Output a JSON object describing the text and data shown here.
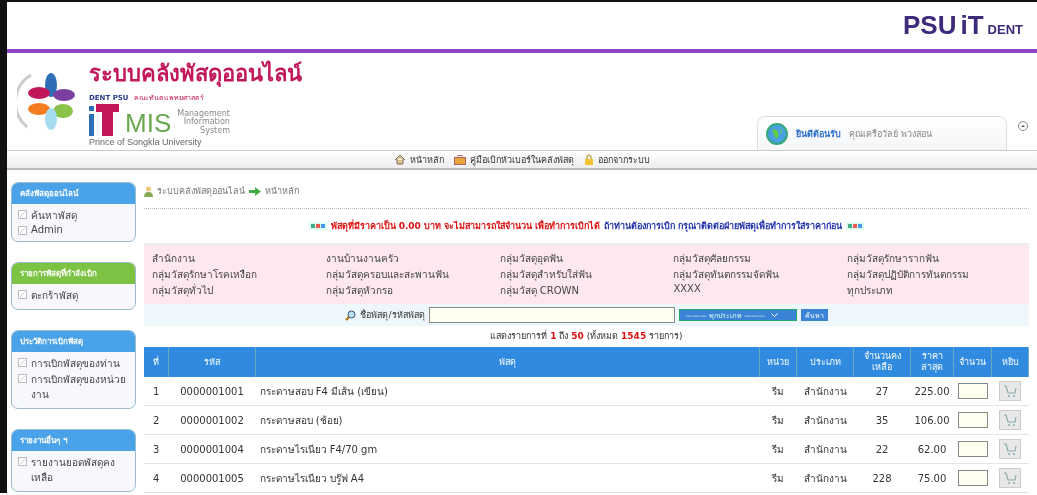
{
  "top_logo": {
    "parts": [
      "PSU",
      "iT",
      "DENT"
    ]
  },
  "header": {
    "title": "ระบบคลังพัสดุออนไลน์",
    "org_short": "DENT PSU",
    "org_name": "คณะทันตแพทยศาสตร์",
    "product": "MIS",
    "product_sub": [
      "Management",
      "Information",
      "System"
    ],
    "university": "Prince of Songkla University"
  },
  "welcome": {
    "greeting": "ยินดีต้อนรับ",
    "user": "คุณเครือวัลย์ พวงสอน"
  },
  "nav": [
    {
      "label": "หน้าหลัก",
      "kind": "home"
    },
    {
      "label": "คู่มือเบิกหัวเบอร์ในคลังพัสดุ",
      "kind": "manual"
    },
    {
      "label": "ออกจากระบบ",
      "kind": "logout"
    }
  ],
  "sidebar": [
    {
      "title": "คลังพัสดุออนไลน์",
      "color": "#4aa3e8",
      "items": [
        "ค้นหาพัสดุ",
        "Admin"
      ]
    },
    {
      "title": "รายการพัสดุที่กำลังเบิก",
      "color": "#7cc243",
      "items": [
        "ตะกร้าพัสดุ"
      ]
    },
    {
      "title": "ประวัติการเบิกพัสดุ",
      "color": "#4aa3e8",
      "items": [
        "การเบิกพัสดุของท่าน",
        "การเบิกพัสดุของหน่วยงาน"
      ]
    },
    {
      "title": "รายงานอื่นๆ ฯ",
      "color": "#4aa3e8",
      "items": [
        "รายงานยอดพัสดุคงเหลือ"
      ]
    }
  ],
  "breadcrumb": [
    "ระบบคลังพัสดุออนไลน์",
    "หน้าหลัก"
  ],
  "notice": {
    "warning": "พัสดุที่มีราคาเป็น 0.00 บาท จะไม่สามารถใส่จำนวน เพื่อทำการเบิกได้",
    "advice": "ถ้าท่านต้องการเบิก กรุณาติดต่อฝ่ายพัสดุเพื่อทำการใส่ราคาก่อน"
  },
  "categories": [
    "สำนักงาน",
    "งานบ้านงานครัว",
    "กลุ่มวัสดุอุดฟัน",
    "กลุ่มวัสดุศัลยกรรม",
    "กลุ่มวัสดุรักษารากฟัน",
    "กลุ่มวัสดุรักษาโรคเหงือก",
    "กลุ่มวัสดุครอบและสะพานฟัน",
    "กลุ่มวัสดุสำหรับใส่ฟัน",
    "กลุ่มวัสดุทันตกรรมจัดฟัน",
    "กลุ่มวัสดุปฏิบัติการทันตกรรม",
    "กลุ่มวัสดุทั่วไป",
    "กลุ่มวัสดุหัวกรอ",
    "กลุ่มวัสดุ CROWN",
    "XXXX",
    "ทุกประเภท"
  ],
  "search": {
    "label": "ชื่อพัสดุ/รหัสพัสดุ",
    "type_select": "——— ทุกประเภท ———",
    "button": "ค้นหา"
  },
  "summary": [
    {
      "text": "แสดงรายการที่ ",
      "highlight": false
    },
    {
      "text": "1",
      "highlight": true
    },
    {
      "text": " ถึง ",
      "highlight": false
    },
    {
      "text": "50",
      "highlight": true
    },
    {
      "text": " (ทั้งหมด ",
      "highlight": false
    },
    {
      "text": "1545",
      "highlight": true
    },
    {
      "text": " รายการ)",
      "highlight": false
    }
  ],
  "table": {
    "columns": [
      "ที่",
      "รหัส",
      "พัสดุ",
      "หน่วย",
      "ประเภท",
      "จำนวนคงเหลือ",
      "ราคาล่าสุด",
      "จำนวน",
      "หยิบ"
    ],
    "rows": [
      [
        "1",
        "0000001001",
        "กระดาษสอบ F4 มีเส้น (เขียน)",
        "รีม",
        "สำนักงาน",
        "27",
        "225.00"
      ],
      [
        "2",
        "0000001002",
        "กระดาษสอบ (ช้อย)",
        "รีม",
        "สำนักงาน",
        "35",
        "106.00"
      ],
      [
        "3",
        "0000001004",
        "กระดาษไรเนียว F4/70 gm",
        "รีม",
        "สำนักงาน",
        "22",
        "62.00"
      ],
      [
        "4",
        "0000001005",
        "กระดาษไรเนียว บรู๊ฟ A4",
        "รีม",
        "สำนักงาน",
        "228",
        "75.00"
      ]
    ]
  }
}
